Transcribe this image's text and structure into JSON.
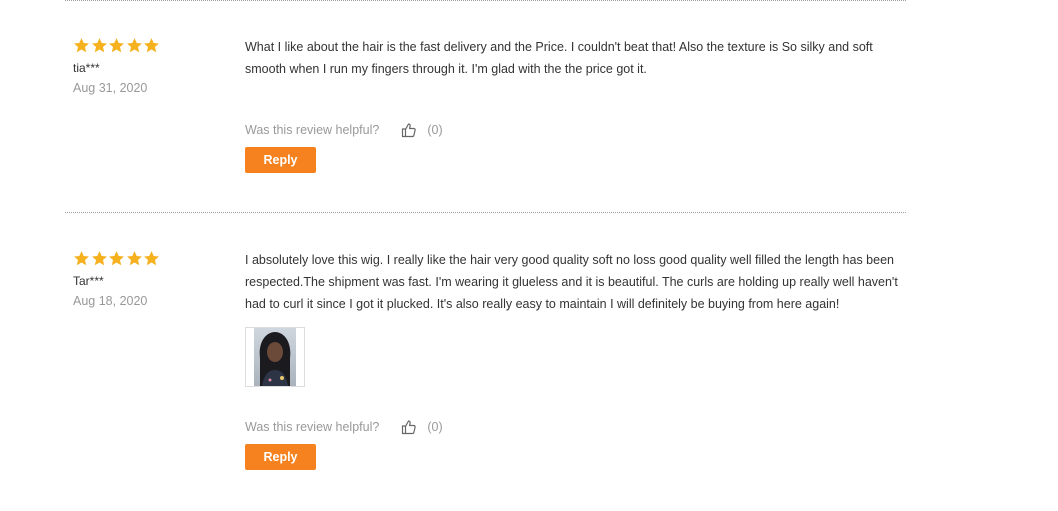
{
  "colors": {
    "star": "#F5B11E",
    "reply_button": "#F5821F",
    "muted_text": "#999999",
    "body_text": "#333333",
    "divider": "#9E9E9E"
  },
  "reviews": [
    {
      "rating": 5,
      "username": "tia***",
      "date": "Aug 31, 2020",
      "text": "What I like about the hair is the fast delivery and the Price. I couldn't beat that! Also the texture is So silky and soft smooth when I run my fingers through it. I'm glad with the the price got it.",
      "helpful_label": "Was this review helpful?",
      "helpful_count": "(0)",
      "reply_label": "Reply"
    },
    {
      "rating": 5,
      "username": "Tar***",
      "date": "Aug 18, 2020",
      "text": "I absolutely love this wig. I really like the hair very good quality soft no loss good quality well filled the length has been respected.The shipment was fast. I'm wearing it glueless and it is beautiful. The curls are holding up really well haven't had to curl it since I got it plucked. It's also really easy to maintain I will definitely be buying from here again!",
      "helpful_label": "Was this review helpful?",
      "helpful_count": "(0)",
      "reply_label": "Reply"
    }
  ]
}
